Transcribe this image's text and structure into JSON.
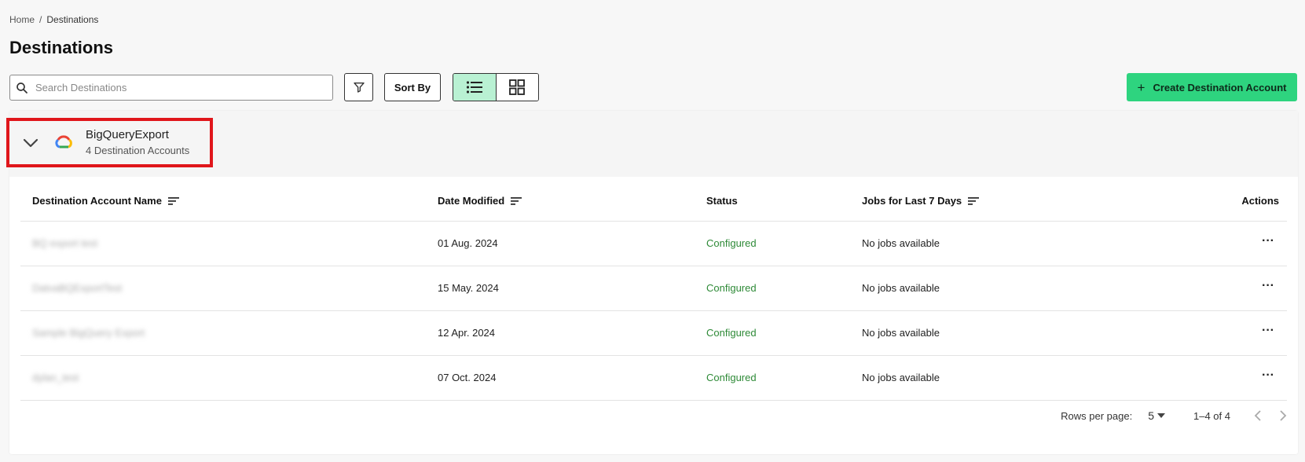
{
  "breadcrumb": {
    "home": "Home",
    "separator": "/",
    "current": "Destinations"
  },
  "page_title": "Destinations",
  "toolbar": {
    "search_placeholder": "Search Destinations",
    "sort_label": "Sort By",
    "create_label": "Create Destination Account",
    "create_icon": "plus-icon",
    "accent_color": "#2ed47f",
    "active_view": "list"
  },
  "group": {
    "name": "BigQueryExport",
    "subtitle": "4 Destination Accounts",
    "icon": "google-cloud-icon",
    "expanded": true
  },
  "table": {
    "headers": {
      "name": "Destination Account Name",
      "date": "Date Modified",
      "status": "Status",
      "jobs": "Jobs for Last 7 Days",
      "actions": "Actions"
    },
    "rows": [
      {
        "name": "BQ export test",
        "date": "01 Aug. 2024",
        "status": "Configured",
        "jobs": "No jobs available"
      },
      {
        "name": "DatvaBQExportTest",
        "date": "15 May. 2024",
        "status": "Configured",
        "jobs": "No jobs available"
      },
      {
        "name": "Sample BigQuery Export",
        "date": "12 Apr. 2024",
        "status": "Configured",
        "jobs": "No jobs available"
      },
      {
        "name": "dylan_test",
        "date": "07 Oct. 2024",
        "status": "Configured",
        "jobs": "No jobs available"
      }
    ],
    "status_color": "#2e8a37"
  },
  "pagination": {
    "rows_per_page_label": "Rows per page:",
    "rows_per_page": "5",
    "range": "1–4 of 4"
  }
}
